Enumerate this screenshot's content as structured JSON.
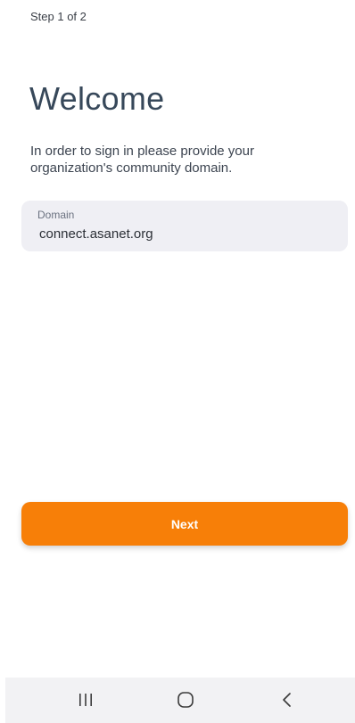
{
  "header": {
    "step_text": "Step 1 of 2"
  },
  "main": {
    "title": "Welcome",
    "description": "In order to sign in please provide your organization's community domain.",
    "domain_field": {
      "label": "Domain",
      "value": "connect.asanet.org"
    },
    "next_button_label": "Next"
  },
  "colors": {
    "accent": "#f77f08",
    "field_background": "#efeff4",
    "title": "#37485a"
  },
  "system_nav": {
    "icons": [
      "recent-apps-icon",
      "home-icon",
      "back-icon"
    ]
  }
}
